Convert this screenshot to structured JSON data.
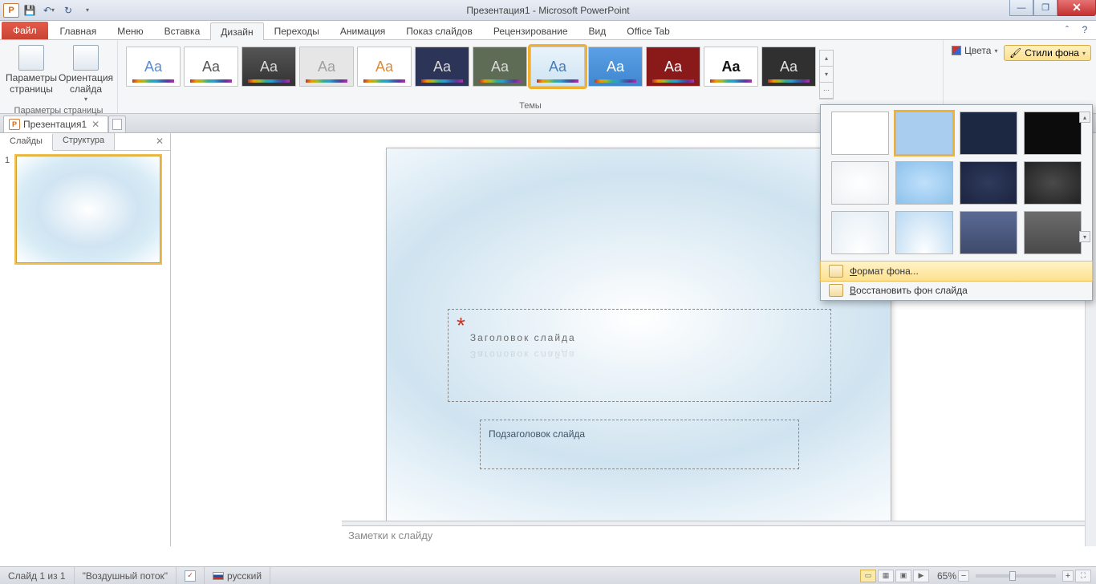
{
  "titlebar": {
    "title": "Презентация1 - Microsoft PowerPoint"
  },
  "tabs": {
    "file": "Файл",
    "items": [
      "Главная",
      "Меню",
      "Вставка",
      "Дизайн",
      "Переходы",
      "Анимация",
      "Показ слайдов",
      "Рецензирование",
      "Вид",
      "Office Tab"
    ],
    "active": "Дизайн"
  },
  "ribbon": {
    "page_setup_group": "Параметры страницы",
    "page_setup_btn": "Параметры страницы",
    "orientation_btn": "Ориентация слайда",
    "themes_group": "Темы",
    "colors_btn": "Цвета",
    "bg_styles_btn": "Стили фона"
  },
  "bg_popup": {
    "format_bg": "Формат фона...",
    "reset_bg": "Восстановить фон слайда",
    "format_hot": "Ф",
    "reset_hot": "В"
  },
  "doc_tabs": {
    "name": "Презентация1"
  },
  "side": {
    "slides_tab": "Слайды",
    "outline_tab": "Структура",
    "num": "1"
  },
  "slide": {
    "title": "Заголовок слайда",
    "subtitle": "Подзаголовок слайда"
  },
  "notes": {
    "placeholder": "Заметки к слайду"
  },
  "status": {
    "slide_of": "Слайд 1 из 1",
    "theme": "\"Воздушный поток\"",
    "lang": "русский",
    "zoom": "65%"
  },
  "themes": [
    {
      "bg": "#ffffff",
      "fg": "#5b8bd0"
    },
    {
      "bg": "#ffffff",
      "fg": "#555555"
    },
    {
      "bg": "linear-gradient(#555,#333)",
      "fg": "#d9d9d9"
    },
    {
      "bg": "#e6e6e6",
      "fg": "#a0a0a0"
    },
    {
      "bg": "#ffffff",
      "fg": "#d98c3e"
    },
    {
      "bg": "#2c3457",
      "fg": "#d9d9d9"
    },
    {
      "bg": "#5e6b55",
      "fg": "#d9d9d9"
    },
    {
      "bg": "linear-gradient(#e9f3fb,#cfe4f2)",
      "fg": "#4a7db5"
    },
    {
      "bg": "linear-gradient(#5aa0e6,#3f87cf)",
      "fg": "#ffffff"
    },
    {
      "bg": "#8a1a1a",
      "fg": "#ffffff"
    },
    {
      "bg": "#ffffff",
      "fg": "#111111",
      "bold": true
    },
    {
      "bg": "#303030",
      "fg": "#e0e0e0"
    }
  ],
  "bg_swatches": [
    "#ffffff",
    "linear-gradient(#a9cdef,#a9cdef)",
    "#1c2742",
    "#0c0c0c",
    "radial-gradient(ellipse at center,#fff,#eef1f4)",
    "radial-gradient(ellipse at center,#bfe0fb,#8dc1ea)",
    "radial-gradient(ellipse at center,#2e3a5c,#1b2440)",
    "radial-gradient(ellipse at center,#4a4a4a,#222)",
    "radial-gradient(ellipse at 50% 100%,#fff,#e3edf5)",
    "radial-gradient(ellipse at 50% 100%,#fff,#b7d8f2)",
    "linear-gradient(#5a6a94,#3e4a6c)",
    "linear-gradient(#6c6c6c,#494949)"
  ]
}
